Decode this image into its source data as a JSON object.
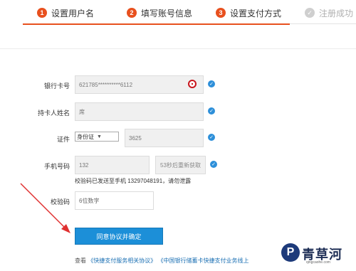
{
  "steps": [
    {
      "num": "1",
      "label": "设置用户名"
    },
    {
      "num": "2",
      "label": "填写账号信息"
    },
    {
      "num": "3",
      "label": "设置支付方式"
    },
    {
      "num": "✓",
      "label": "注册成功"
    }
  ],
  "form": {
    "card_label": "银行卡号",
    "card_value": "621785**********6112",
    "holder_label": "持卡人姓名",
    "holder_value": "席",
    "id_label": "证件",
    "id_type": "身份证",
    "id_value": "3625",
    "phone_label": "手机号码",
    "phone_value": "132",
    "resend_label": "53秒后重新获取",
    "sms_notice": "校验码已发送至手机 13297048191，请勿泄露",
    "code_label": "校验码",
    "code_placeholder": "6位数字"
  },
  "submit_label": "同意协议并确定",
  "agreement": {
    "prefix": "查看",
    "link1": "《快捷支付服务相关协议》",
    "link2": "《中国银行储蓄卡快捷支付业务线上"
  },
  "watermark": {
    "logo_text": "P",
    "brand": "青草河",
    "url": "qingcaohe.com"
  },
  "colors": {
    "accent": "#e8501e",
    "primary": "#1c8fd8",
    "check": "#2d8fd9",
    "annotation_arrow": "#e03030"
  }
}
